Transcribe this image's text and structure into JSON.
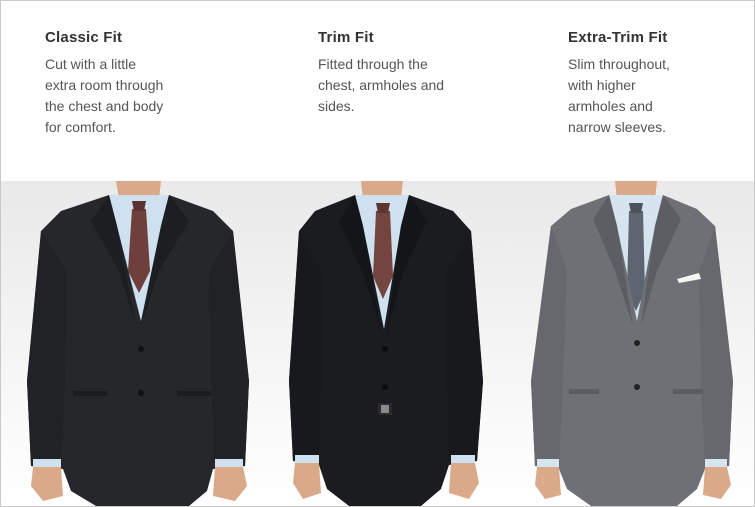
{
  "fits": [
    {
      "title": "Classic Fit",
      "description": "Cut with a little\nextra room through\nthe chest and body\nfor comfort."
    },
    {
      "title": "Trim Fit",
      "description": "Fitted through the\nchest, armholes and\nsides."
    },
    {
      "title": "Extra-Trim Fit",
      "description": "Slim throughout,\nwith higher\narmholes and\nnarrow sleeves."
    }
  ],
  "colors": {
    "classic_suit": "#25272b",
    "trim_suit": "#1b1c1f",
    "extra_suit": "#6e7075",
    "shirt": "#cfe0ee",
    "skin": "#d9a98a",
    "classic_tie": "#6e3f3c",
    "trim_tie": "#74443e",
    "extra_tie": "#5d6570"
  }
}
